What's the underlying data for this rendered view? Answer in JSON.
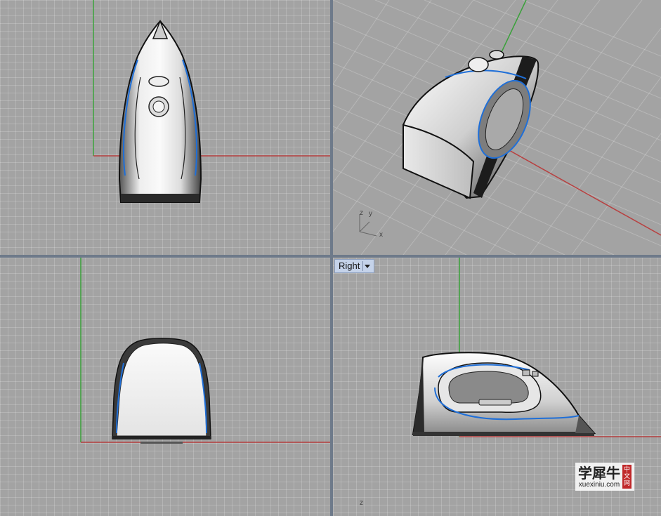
{
  "viewports": {
    "top": {
      "label": ""
    },
    "perspective": {
      "label": "",
      "axis_z": "z",
      "axis_y": "y",
      "axis_x": "x"
    },
    "front": {
      "label": ""
    },
    "right": {
      "label": "Right",
      "axis_z": "z"
    }
  },
  "watermark": {
    "cn": "学犀牛",
    "en": "xuexiniu.com",
    "badge": [
      "中",
      "文",
      "网"
    ]
  },
  "colors": {
    "grid_bg": "#a3a3a3",
    "x_axis": "#b84040",
    "y_axis": "#3aa13a",
    "edge_blue": "#1f6fd8",
    "label_bg": "#c5d3ea"
  },
  "icons": {
    "viewport_menu": "chevron-down-icon",
    "model": "iron-model"
  }
}
